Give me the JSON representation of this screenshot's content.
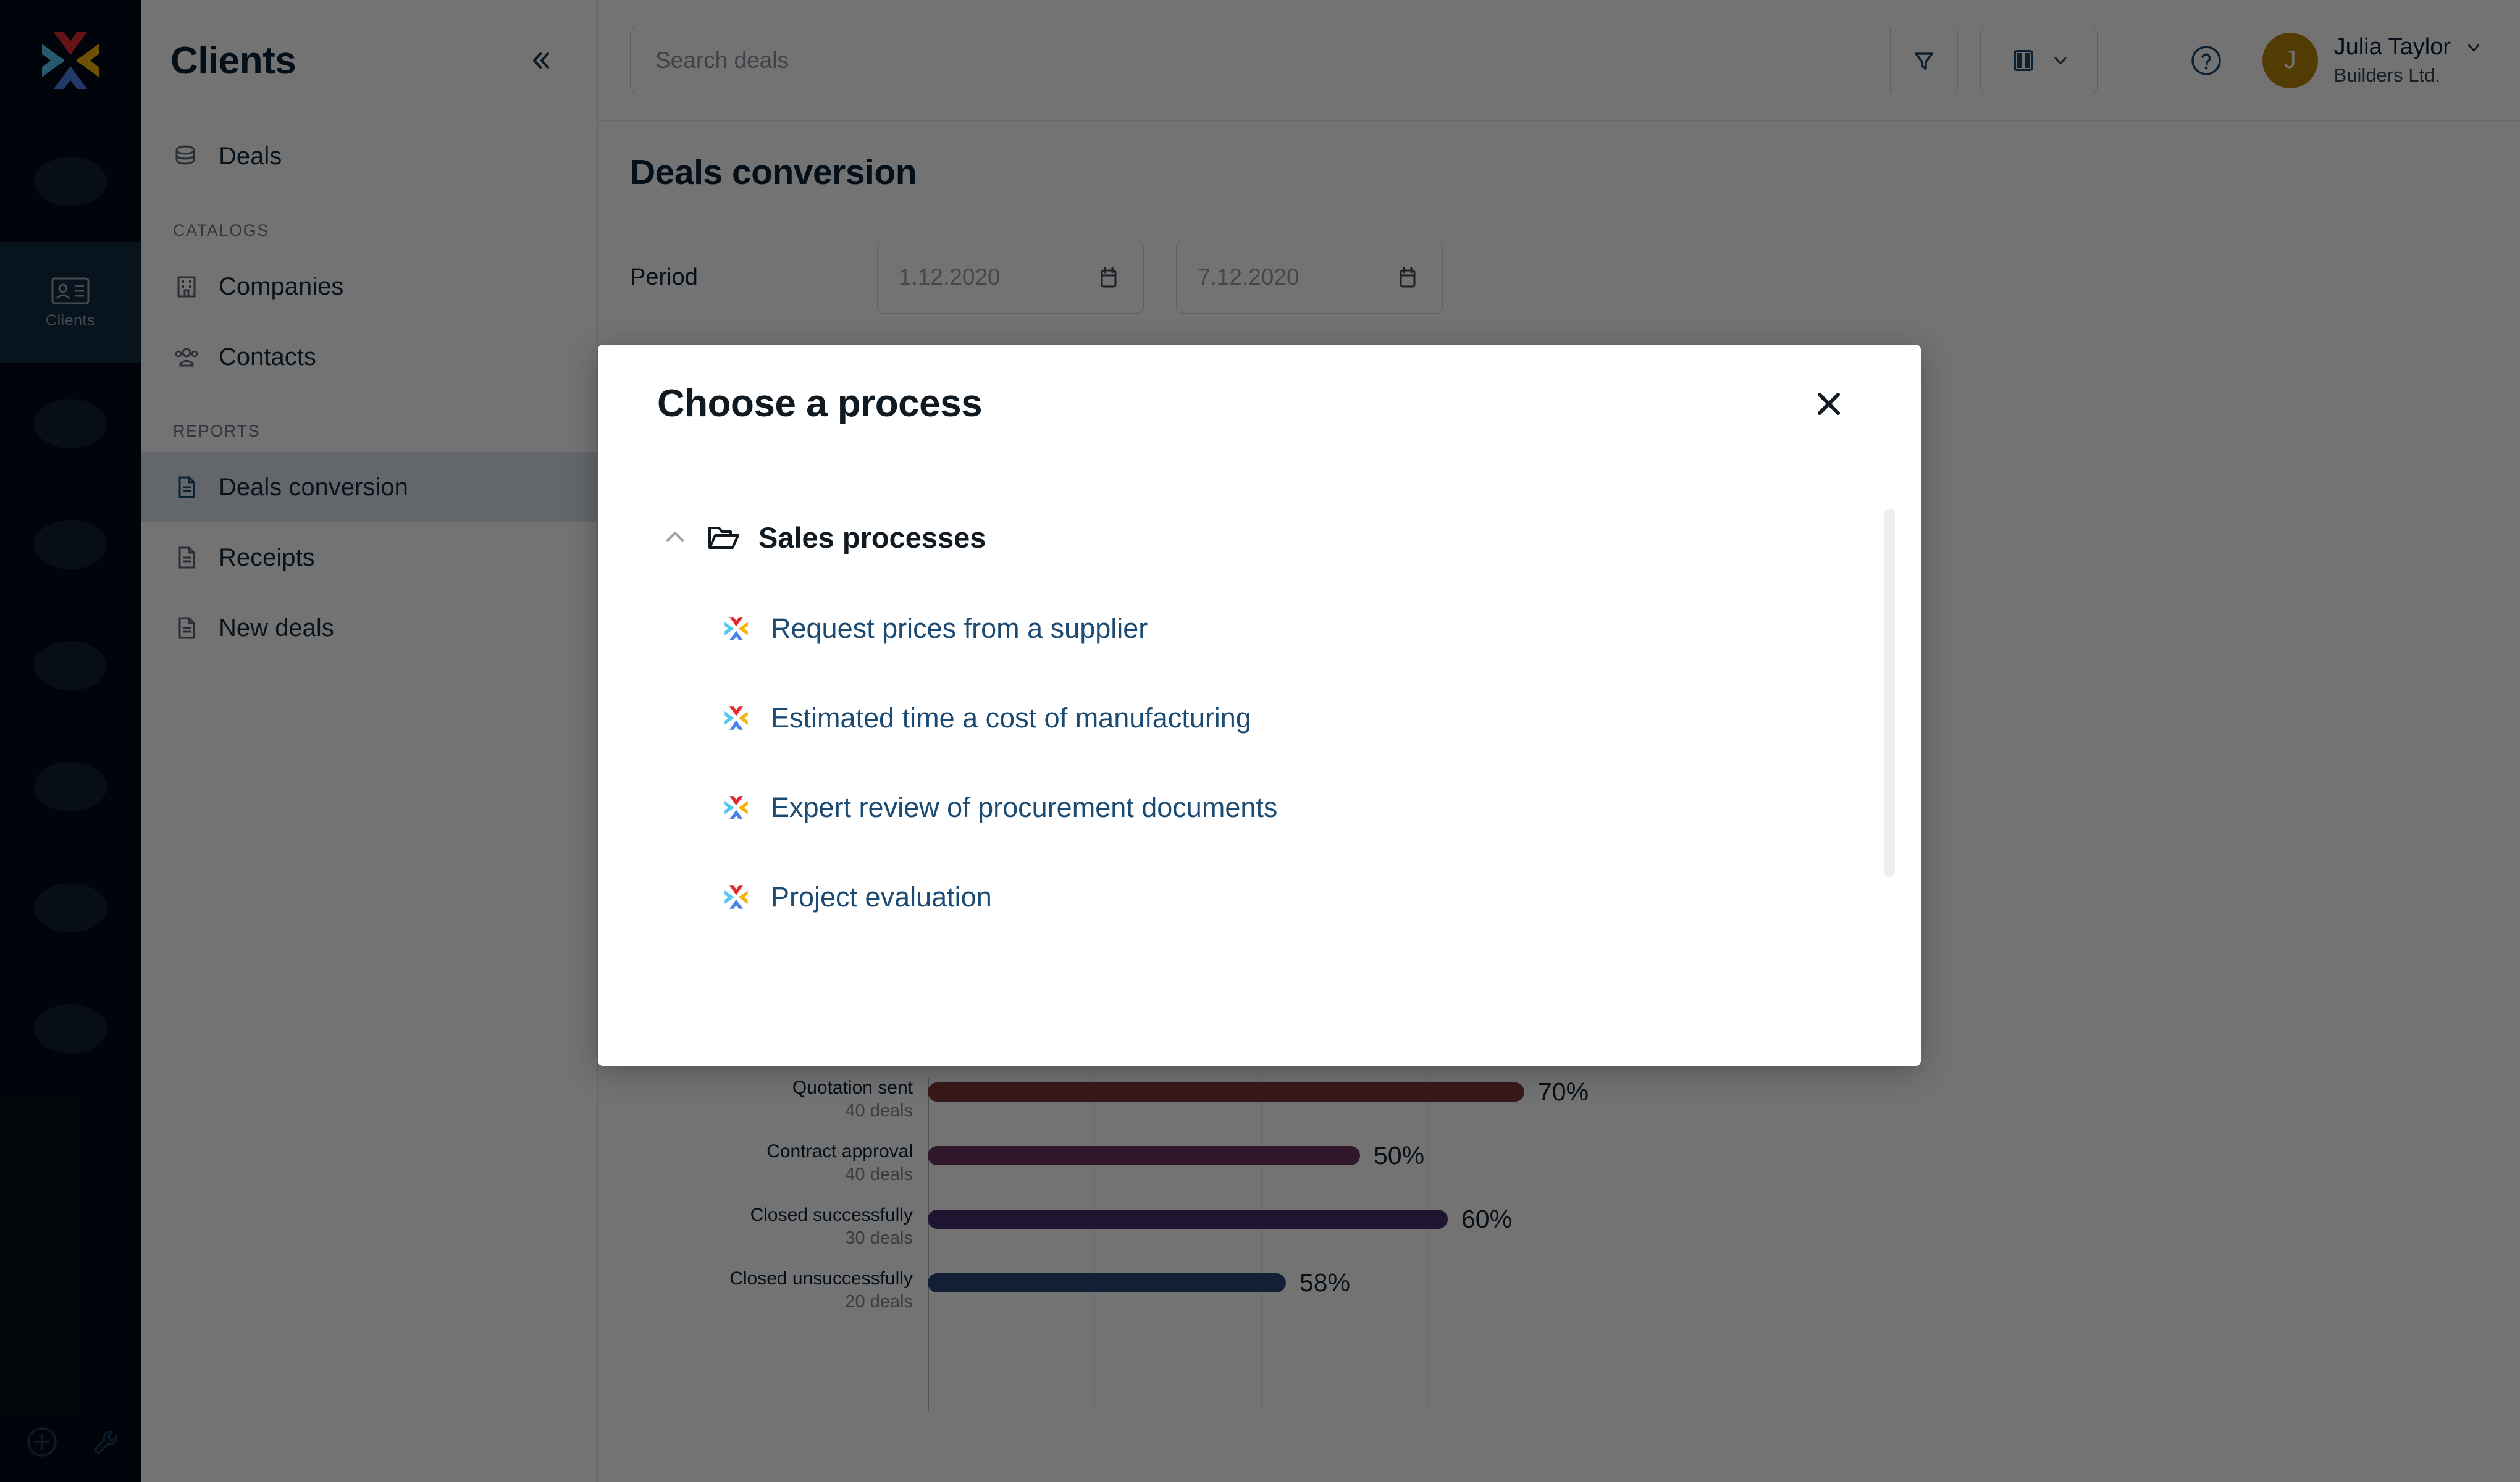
{
  "brand": {
    "logo_name": "x-logo",
    "accent": "#1b4a72"
  },
  "rail": {
    "items": [
      {
        "name": "rail-blob-1",
        "label": "",
        "icon": "blob",
        "active": false
      },
      {
        "name": "rail-item-clients",
        "label": "Clients",
        "icon": "id-card-icon",
        "active": true
      },
      {
        "name": "rail-blob-2",
        "label": "",
        "icon": "blob",
        "active": false
      },
      {
        "name": "rail-blob-3",
        "label": "",
        "icon": "blob",
        "active": false
      },
      {
        "name": "rail-blob-4",
        "label": "",
        "icon": "blob",
        "active": false
      },
      {
        "name": "rail-blob-5",
        "label": "",
        "icon": "blob",
        "active": false
      },
      {
        "name": "rail-blob-6",
        "label": "",
        "icon": "blob",
        "active": false
      },
      {
        "name": "rail-blob-7",
        "label": "",
        "icon": "blob",
        "active": false
      }
    ],
    "bottom": [
      {
        "name": "add-button",
        "icon": "plus-circle-icon"
      },
      {
        "name": "settings-button",
        "icon": "wrench-icon"
      }
    ]
  },
  "sidebar": {
    "title": "Clients",
    "collapse_icon": "double-chevron-left-icon",
    "groups": [
      {
        "section": null,
        "items": [
          {
            "label": "Deals",
            "icon": "coins-icon",
            "active": false
          }
        ]
      },
      {
        "section": "CATALOGS",
        "items": [
          {
            "label": "Companies",
            "icon": "building-icon",
            "active": false
          },
          {
            "label": "Contacts",
            "icon": "people-icon",
            "active": false
          }
        ]
      },
      {
        "section": "REPORTS",
        "items": [
          {
            "label": "Deals conversion",
            "icon": "document-icon",
            "active": true
          },
          {
            "label": "Receipts",
            "icon": "document-icon",
            "active": false
          },
          {
            "label": "New deals",
            "icon": "document-icon",
            "active": false
          }
        ]
      }
    ]
  },
  "topbar": {
    "search": {
      "value": "",
      "placeholder": "Search deals",
      "icon": "search-input"
    },
    "filter_icon": "filter-icon",
    "view_icon": "columns-icon",
    "view_chevron_icon": "chevron-down-icon",
    "help_icon": "question-circle-icon",
    "user": {
      "initial": "J",
      "name": "Julia Taylor",
      "org": "Builders Ltd.",
      "chevron_icon": "chevron-down-icon",
      "avatar_color": "#b8860b"
    }
  },
  "page": {
    "title": "Deals conversion",
    "period_label": "Period",
    "date_from": {
      "value": "1.12.2020",
      "icon": "calendar-icon"
    },
    "date_to": {
      "value": "7.12.2020",
      "icon": "calendar-icon"
    }
  },
  "chart_data": {
    "type": "bar",
    "orientation": "horizontal",
    "title": "Deals conversion",
    "xlabel": "",
    "ylabel": "",
    "grid": true,
    "categories": [
      "Quotation sent",
      "Contract approval",
      "Closed successfully",
      "Closed unsuccessfully"
    ],
    "values": [
      70,
      50,
      60,
      58
    ],
    "value_labels": [
      "70%",
      "50%",
      "60%",
      "58%"
    ],
    "sublabels": [
      "40 deals",
      "40 deals",
      "30 deals",
      "20 deals"
    ],
    "counts": [
      40,
      40,
      30,
      20
    ],
    "bar_colors": [
      "#7e3b3b",
      "#6e3463",
      "#46306e",
      "#2b4677"
    ],
    "bar_pixel_widths": [
      966,
      700,
      842,
      580
    ],
    "ylim": [
      0,
      100
    ]
  },
  "modal": {
    "title": "Choose a process",
    "close_icon": "close-icon",
    "group": {
      "label": "Sales processes",
      "caret_icon": "chevron-up-icon",
      "folder_icon": "open-folder-icon",
      "expanded": true
    },
    "items": [
      {
        "label": "Request prices from a supplier",
        "icon": "x-logo-icon"
      },
      {
        "label": "Estimated time a cost of manufacturing",
        "icon": "x-logo-icon"
      },
      {
        "label": "Expert review of procurement documents",
        "icon": "x-logo-icon"
      },
      {
        "label": "Project evaluation",
        "icon": "x-logo-icon"
      }
    ],
    "scrollbar": {
      "name": "modal-scrollbar"
    }
  }
}
